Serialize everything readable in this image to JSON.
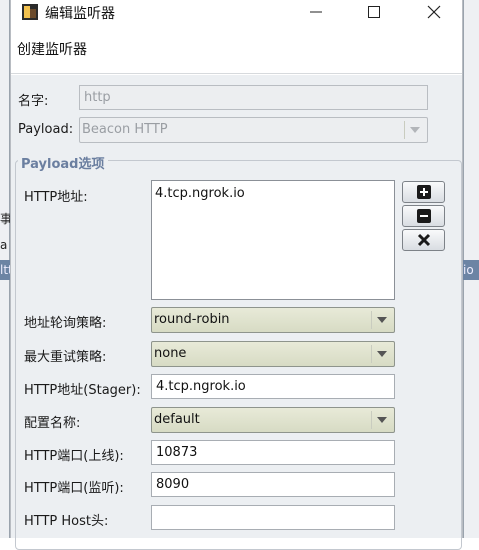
{
  "window": {
    "title": "编辑监听器",
    "controls": {
      "minimize": "—",
      "maximize": "☐",
      "close": "✕"
    }
  },
  "background": {
    "left_fragments": [
      "事",
      "a",
      "ltt"
    ],
    "right_fragment": "io"
  },
  "header": {
    "text": "创建监听器"
  },
  "form": {
    "name": {
      "label": "名字:",
      "value": "http"
    },
    "payload": {
      "label": "Payload:",
      "value": "Beacon HTTP"
    }
  },
  "group": {
    "title": "Payload选项",
    "http_hosts": {
      "label": "HTTP地址:",
      "items": [
        "4.tcp.ngrok.io"
      ]
    },
    "buttons": {
      "add": "add-icon",
      "remove": "remove-icon",
      "clear": "clear-icon"
    },
    "rotation": {
      "label": "地址轮询策略:",
      "value": "round-robin"
    },
    "max_retry": {
      "label": "最大重试策略:",
      "value": "none"
    },
    "stager_host": {
      "label": "HTTP地址(Stager):",
      "value": "4.tcp.ngrok.io"
    },
    "profile": {
      "label": "配置名称:",
      "value": "default"
    },
    "port_c2": {
      "label": "HTTP端口(上线):",
      "value": "10873"
    },
    "port_bind": {
      "label": "HTTP端口(监听):",
      "value": "8090"
    },
    "host_header": {
      "label": "HTTP Host头:",
      "value": ""
    }
  },
  "colors": {
    "group_title": "#6b7fa0",
    "combo_fill": "#d9dcc6",
    "panel": "#eceff2"
  }
}
